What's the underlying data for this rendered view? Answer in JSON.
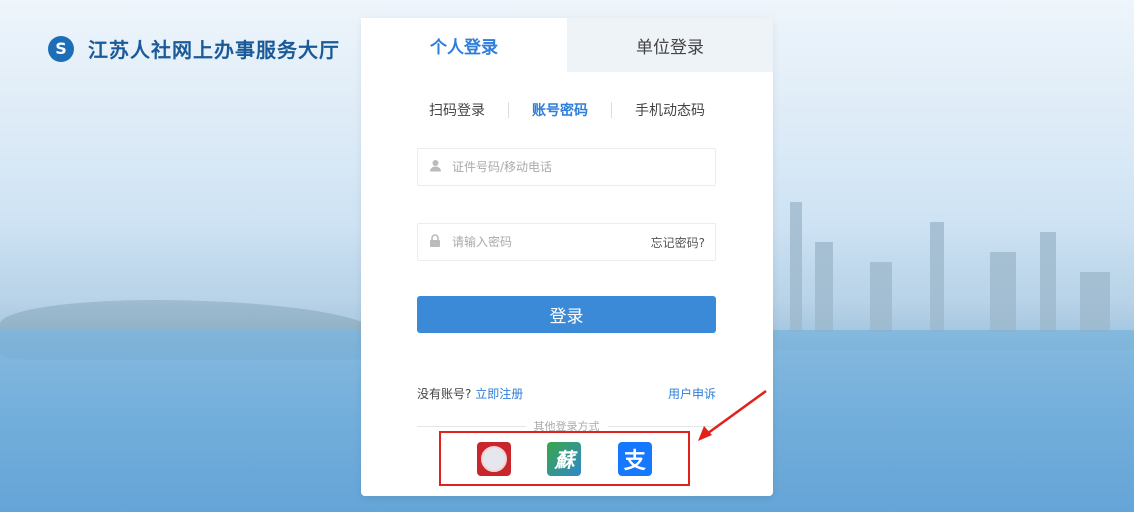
{
  "brand": {
    "title": "江苏人社网上办事服务大厅",
    "logo_glyph": "S"
  },
  "tabs": [
    {
      "label": "个人登录",
      "active": true
    },
    {
      "label": "单位登录",
      "active": false
    }
  ],
  "subtabs": [
    {
      "label": "扫码登录",
      "active": false
    },
    {
      "label": "账号密码",
      "active": true
    },
    {
      "label": "手机动态码",
      "active": false
    }
  ],
  "form": {
    "username_placeholder": "证件号码/移动电话",
    "password_placeholder": "请输入密码",
    "forgot_label": "忘记密码?",
    "login_label": "登录"
  },
  "register": {
    "no_account_text": "没有账号?",
    "register_link": "立即注册",
    "appeal_link": "用户申诉"
  },
  "other_login": {
    "label": "其他登录方式",
    "methods": [
      {
        "name": "jiangsu-renshe-app",
        "icon": "seal-icon"
      },
      {
        "name": "su-app",
        "glyph": "蘇"
      },
      {
        "name": "alipay",
        "glyph": "支"
      }
    ]
  },
  "colors": {
    "accent": "#2f7ed8",
    "login_button": "#3b8ad8",
    "highlight_box": "#e0211c",
    "brand_text": "#1a5a99"
  }
}
